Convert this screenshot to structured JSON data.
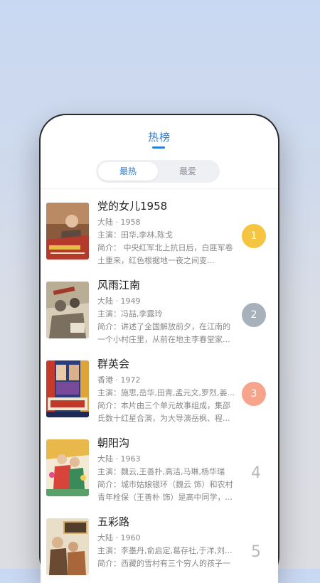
{
  "header": {
    "title": "热榜"
  },
  "tabs": [
    {
      "label": "最热",
      "active": true
    },
    {
      "label": "最爱",
      "active": false
    }
  ],
  "colors": {
    "accent": "#2a7fd6",
    "rank1": "#f5c542",
    "rank2": "#a7b1bb",
    "rank3": "#f6a48c"
  },
  "movies": [
    {
      "title": "党的女儿1958",
      "meta": "大陆 · 1958",
      "cast": "主演：田华,李林,陈戈",
      "desc": "简介：        中央红军北上抗日后，白匪军卷土重来，红色根据地一夜之间变...",
      "rank": "1"
    },
    {
      "title": "风雨江南",
      "meta": "大陆 · 1949",
      "cast": "主演：冯喆,李露玲",
      "desc": "简介：讲述了全国解放前夕，在江南的一个小村庄里，从前在地主李春堂家...",
      "rank": "2"
    },
    {
      "title": "群英会",
      "meta": "香港 · 1972",
      "cast": "主演：施思,岳华,田青,孟元文,罗烈,姜...",
      "desc": "简介：本片由三个单元故事组成，集邵氏数十红星合演，为大导演岳枫、程...",
      "rank": "3"
    },
    {
      "title": "朝阳沟",
      "meta": "大陆 · 1963",
      "cast": "主演：魏云,王善扑,高洁,马琳,杨华瑞",
      "desc": "简介：城市姑娘银环（魏云 饰）和农村青年栓保（王善朴 饰）是高中同学，...",
      "rank": "4"
    },
    {
      "title": "五彩路",
      "meta": "大陆 · 1960",
      "cast": "主演：李墨丹,俞启定,葛存社,于洋,刘...",
      "desc": "简介：西藏的雪村有三个穷人的孩子一",
      "rank": "5"
    }
  ]
}
